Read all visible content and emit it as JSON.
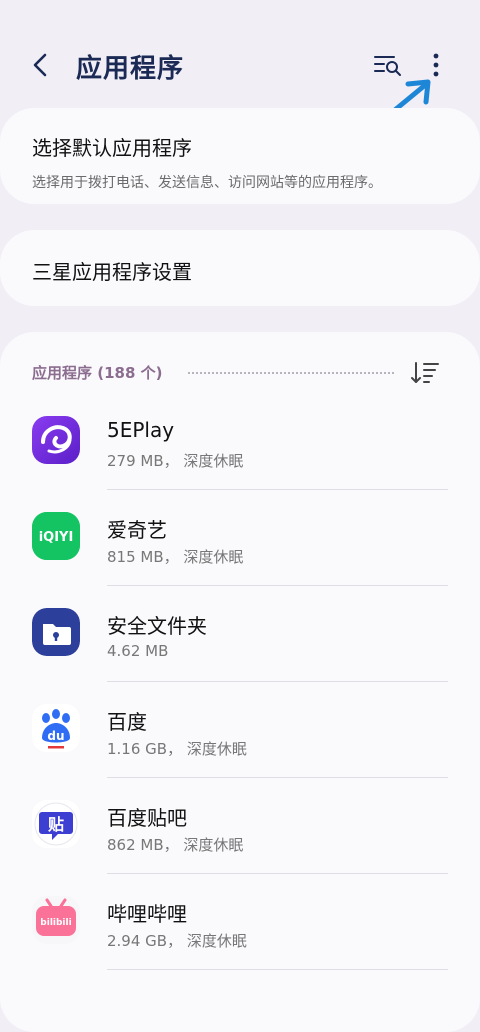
{
  "header": {
    "title": "应用程序",
    "back_icon": "chevron-left-icon",
    "search_icon": "list-search-icon",
    "more_icon": "more-vertical-icon",
    "accent_color": "#1a2a55",
    "hint_arrow_color": "#1e86d6"
  },
  "default_apps": {
    "title": "选择默认应用程序",
    "subtitle": "选择用于拨打电话、发送信息、访问网站等的应用程序。"
  },
  "samsung_settings": {
    "title": "三星应用程序设置"
  },
  "apps": {
    "header_label": "应用程序 (188 个)",
    "header_color": "#8b6d8f",
    "items": [
      {
        "name": "5EPlay",
        "meta": "279 MB， 深度休眠",
        "icon": "5eplay-icon"
      },
      {
        "name": "爱奇艺",
        "meta": "815 MB， 深度休眠",
        "icon": "iqiyi-icon",
        "icon_text": "iQIYI"
      },
      {
        "name": "安全文件夹",
        "meta": "4.62 MB",
        "icon": "secure-folder-icon"
      },
      {
        "name": "百度",
        "meta": "1.16 GB， 深度休眠",
        "icon": "baidu-icon",
        "icon_text": "du"
      },
      {
        "name": "百度贴吧",
        "meta": "862 MB， 深度休眠",
        "icon": "tieba-icon",
        "icon_text": "贴"
      },
      {
        "name": "哔哩哔哩",
        "meta": "2.94 GB， 深度休眠",
        "icon": "bilibili-icon",
        "icon_text": "bilibili"
      }
    ]
  }
}
